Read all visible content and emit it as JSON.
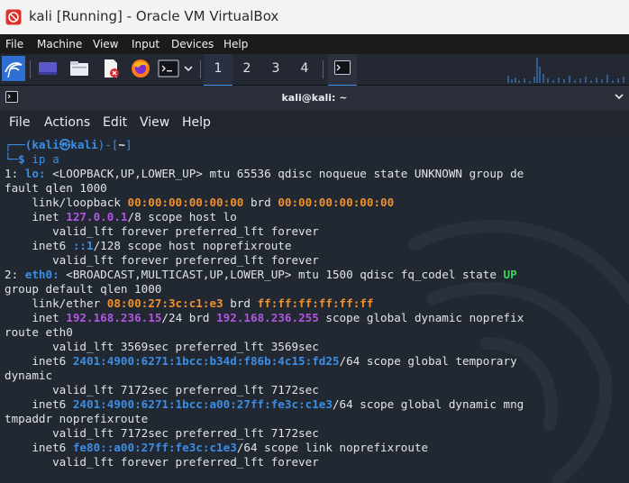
{
  "window": {
    "title": "kali [Running] - Oracle VM VirtualBox"
  },
  "vbox_menu": [
    "File",
    "Machine",
    "View",
    "Input",
    "Devices",
    "Help"
  ],
  "panel": {
    "workspaces": [
      "1",
      "2",
      "3",
      "4"
    ],
    "active_workspace": "1",
    "icons": [
      "kali-menu-icon",
      "show-desktop-icon",
      "file-manager-icon",
      "text-editor-icon",
      "firefox-icon",
      "terminal-launcher-icon"
    ]
  },
  "terminal": {
    "title": "kali@kali: ~",
    "menu": [
      "File",
      "Actions",
      "Edit",
      "View",
      "Help"
    ],
    "prompt": {
      "user": "kali",
      "host": "kali",
      "cwd": "~",
      "command": "ip a"
    },
    "lines": {
      "l1a": "1: ",
      "l1b": "lo:",
      "l1c": " <LOOPBACK,UP,LOWER_UP> mtu 65536 qdisc noqueue state UNKNOWN group de",
      "l2": "fault qlen 1000",
      "l3a": "    link/loopback ",
      "l3b": "00:00:00:00:00:00",
      "l3c": " brd ",
      "l3d": "00:00:00:00:00:00",
      "l4a": "    inet ",
      "l4b": "127.0.0.1",
      "l4c": "/8 scope host lo",
      "l5": "       valid_lft forever preferred_lft forever",
      "l6a": "    inet6 ",
      "l6b": "::1",
      "l6c": "/128 scope host noprefixroute",
      "l7": "       valid_lft forever preferred_lft forever",
      "l8a": "2: ",
      "l8b": "eth0:",
      "l8c": " <BROADCAST,MULTICAST,UP,LOWER_UP> mtu 1500 qdisc fq_codel state ",
      "l8d": "UP",
      "l9": "group default qlen 1000",
      "l10a": "    link/ether ",
      "l10b": "08:00:27:3c:c1:e3",
      "l10c": " brd ",
      "l10d": "ff:ff:ff:ff:ff:ff",
      "l11a": "    inet ",
      "l11b": "192.168.236.15",
      "l11c": "/24 brd ",
      "l11d": "192.168.236.255",
      "l11e": " scope global dynamic noprefix",
      "l12": "route eth0",
      "l13": "       valid_lft 3569sec preferred_lft 3569sec",
      "l14a": "    inet6 ",
      "l14b": "2401:4900:6271:1bcc:b34d:f86b:4c15:fd25",
      "l14c": "/64 scope global temporary",
      "l15": "dynamic",
      "l16": "       valid_lft 7172sec preferred_lft 7172sec",
      "l17a": "    inet6 ",
      "l17b": "2401:4900:6271:1bcc:a00:27ff:fe3c:c1e3",
      "l17c": "/64 scope global dynamic mng",
      "l18": "tmpaddr noprefixroute",
      "l19": "       valid_lft 7172sec preferred_lft 7172sec",
      "l20a": "    inet6 ",
      "l20b": "fe80::a00:27ff:fe3c:c1e3",
      "l20c": "/64 scope link noprefixroute",
      "l21": "       valid_lft forever preferred_lft forever"
    }
  },
  "colors": {
    "prompt_blue": "#3a8ee6",
    "mac_orange": "#f0912e",
    "ipv4_purple": "#b056e0",
    "state_green": "#3fd15a"
  }
}
